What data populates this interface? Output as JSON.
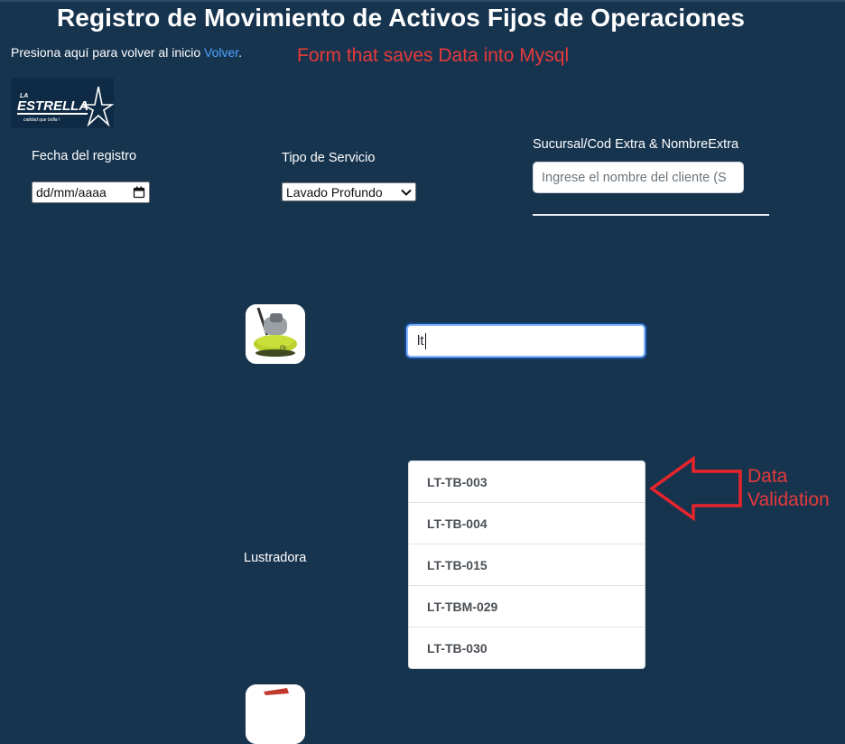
{
  "header": {
    "title": "Registro de Movimiento de Activos Fijos de Operaciones",
    "back_text": "Presiona aquí para volver al inicio ",
    "back_link": "Volver",
    "back_suffix": "."
  },
  "annotations": {
    "top": "Form that saves Data into Mysql",
    "right_line1": "Data",
    "right_line2": "Validation"
  },
  "logo": {
    "text_top": "LA",
    "text_main": "ESTRELLA",
    "tagline": "calidad que brilla !"
  },
  "form": {
    "date_label": "Fecha del registro",
    "date_value": "dd/mm/aaaa",
    "service_label": "Tipo de Servicio",
    "service_value": "Lavado Profundo",
    "client_label": "Sucursal/Cod Extra & NombreExtra",
    "client_placeholder": "Ingrese el nombre del cliente (S",
    "code_value": "lt"
  },
  "item": {
    "label": "Lustradora"
  },
  "suggestions": [
    "LT-TB-003",
    "LT-TB-004",
    "LT-TB-015",
    "LT-TBM-029",
    "LT-TB-030"
  ],
  "colors": {
    "background": "#17344f",
    "link": "#4ea3ff",
    "annotation": "#e63a3a"
  }
}
